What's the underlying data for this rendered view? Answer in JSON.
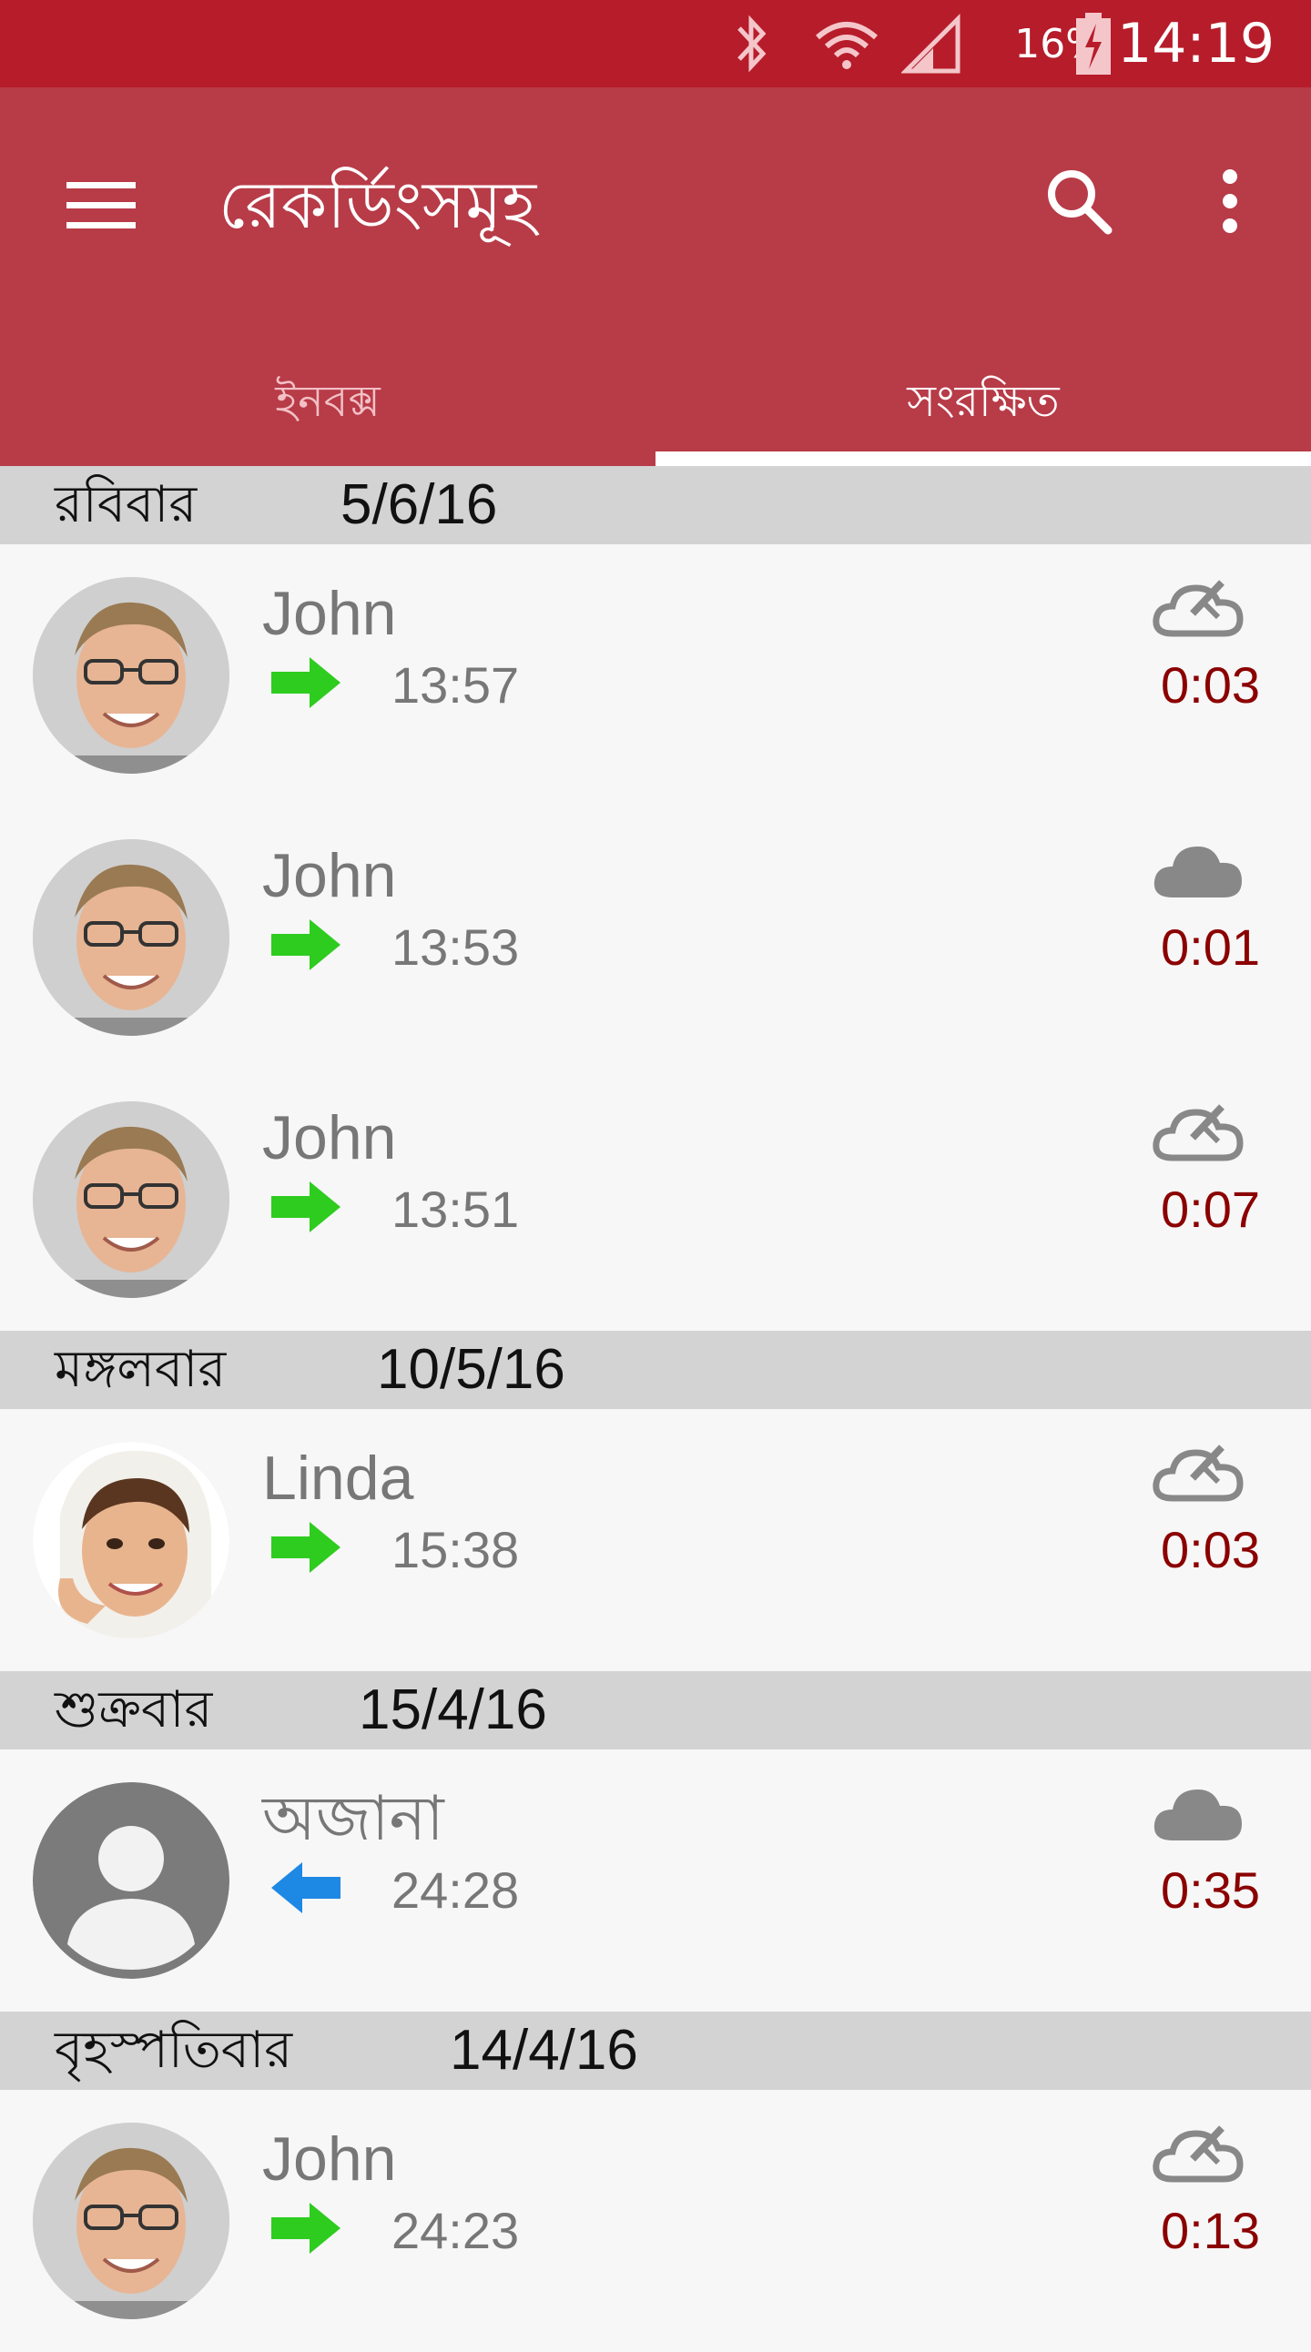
{
  "status_bar": {
    "battery": "16%",
    "time": "14:19"
  },
  "app_bar": {
    "title": "রেকর্ডিংসমূহ"
  },
  "tabs": [
    {
      "label": "ইনবক্স"
    },
    {
      "label": "সংরক্ষিত"
    }
  ],
  "selected_tab": "সংরক্ষিত",
  "colors": {
    "status_bar": "#b71c2a",
    "app_bar": "#b83b48",
    "outgoing_arrow": "#2ecc1f",
    "incoming_arrow": "#1e88e5",
    "duration": "#8b0000"
  },
  "sections": [
    {
      "day": "রবিবার",
      "date": "5/6/16",
      "items": [
        {
          "name": "John",
          "time": "13:57",
          "duration": "0:03",
          "direction": "outgoing",
          "cloud": "cloud-off-icon",
          "avatar": "john"
        },
        {
          "name": "John",
          "time": "13:53",
          "duration": "0:01",
          "direction": "outgoing",
          "cloud": "cloud-filled-icon",
          "avatar": "john"
        },
        {
          "name": "John",
          "time": "13:51",
          "duration": "0:07",
          "direction": "outgoing",
          "cloud": "cloud-off-icon",
          "avatar": "john"
        }
      ]
    },
    {
      "day": "মঙ্গলবার",
      "date": "10/5/16",
      "items": [
        {
          "name": "Linda",
          "time": "15:38",
          "duration": "0:03",
          "direction": "outgoing",
          "cloud": "cloud-off-icon",
          "avatar": "linda"
        }
      ]
    },
    {
      "day": "শুক্রবার",
      "date": "15/4/16",
      "items": [
        {
          "name": "অজানা",
          "time": "24:28",
          "duration": "0:35",
          "direction": "incoming",
          "cloud": "cloud-filled-icon",
          "avatar": "unknown"
        }
      ]
    },
    {
      "day": "বৃহস্পতিবার",
      "date": "14/4/16",
      "items": [
        {
          "name": "John",
          "time": "24:23",
          "duration": "0:13",
          "direction": "outgoing",
          "cloud": "cloud-off-icon",
          "avatar": "john"
        }
      ]
    }
  ]
}
